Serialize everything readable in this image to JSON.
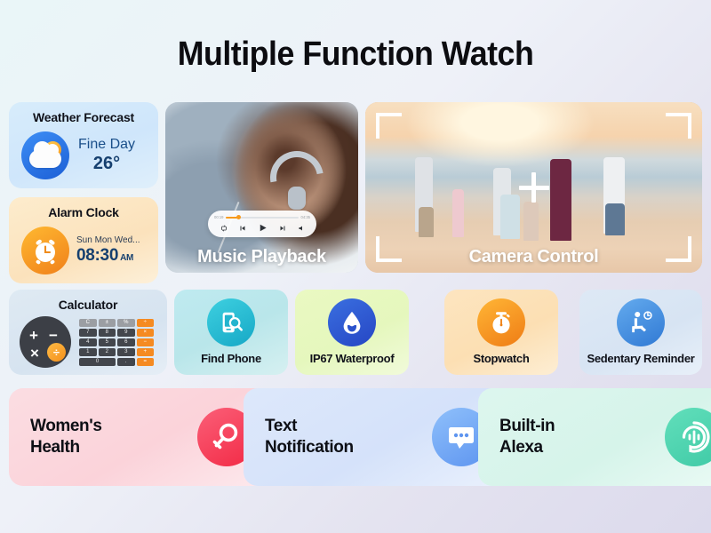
{
  "page": {
    "title": "Multiple Function Watch"
  },
  "weather": {
    "title": "Weather Forecast",
    "condition": "Fine Day",
    "temperature": "26°",
    "icon": "sun-cloud-icon"
  },
  "alarm": {
    "title": "Alarm Clock",
    "days": "Sun Mon Wed...",
    "time": "08:30",
    "meridiem": "AM",
    "icon": "alarm-clock-icon"
  },
  "calculator": {
    "title": "Calculator",
    "icon": "calculator-icon",
    "circle_symbols": [
      "+",
      "−",
      "×",
      "÷"
    ],
    "keypad": [
      {
        "label": "C",
        "style": "gray"
      },
      {
        "label": "±",
        "style": "gray"
      },
      {
        "label": "%",
        "style": "gray"
      },
      {
        "label": "÷",
        "style": "orange"
      },
      {
        "label": "7",
        "style": "dark"
      },
      {
        "label": "8",
        "style": "dark"
      },
      {
        "label": "9",
        "style": "dark"
      },
      {
        "label": "×",
        "style": "orange"
      },
      {
        "label": "4",
        "style": "dark"
      },
      {
        "label": "5",
        "style": "dark"
      },
      {
        "label": "6",
        "style": "dark"
      },
      {
        "label": "−",
        "style": "orange"
      },
      {
        "label": "1",
        "style": "dark"
      },
      {
        "label": "2",
        "style": "dark"
      },
      {
        "label": "3",
        "style": "dark"
      },
      {
        "label": "+",
        "style": "orange"
      },
      {
        "label": "0",
        "style": "dark wide"
      },
      {
        "label": ".",
        "style": "dark"
      },
      {
        "label": "=",
        "style": "orange"
      }
    ]
  },
  "music": {
    "label": "Music Playback",
    "elapsed": "00:19",
    "duration": "04:35",
    "progress_percent": 16,
    "controls": [
      "repeat-icon",
      "previous-track-icon",
      "play-icon",
      "next-track-icon",
      "volume-icon"
    ]
  },
  "camera": {
    "label": "Camera Control",
    "crosshair_icon": "camera-crosshair-icon",
    "frame_icon": "viewfinder-corners-icon"
  },
  "features": [
    {
      "label": "Find Phone",
      "icon": "phone-search-icon"
    },
    {
      "label": "IP67 Waterproof",
      "icon": "water-drop-icon"
    },
    {
      "label": "Stopwatch",
      "icon": "stopwatch-icon"
    },
    {
      "label": "Sedentary Reminder",
      "icon": "seated-person-clock-icon"
    }
  ],
  "bottom_cards": [
    {
      "label_line1": "Women's",
      "label_line2": "Health",
      "icon": "female-symbol-icon"
    },
    {
      "label_line1": "Text",
      "label_line2": "Notification",
      "icon": "speech-bubble-icon"
    },
    {
      "label_line1": "Built-in",
      "label_line2": "Alexa",
      "icon": "alexa-waveform-icon"
    }
  ],
  "colors": {
    "accent_orange": "#f58a21",
    "accent_blue": "#1c5fd6",
    "accent_pink": "#f22a45",
    "accent_teal": "#3fcaa6",
    "title_text": "#0c0c10"
  }
}
